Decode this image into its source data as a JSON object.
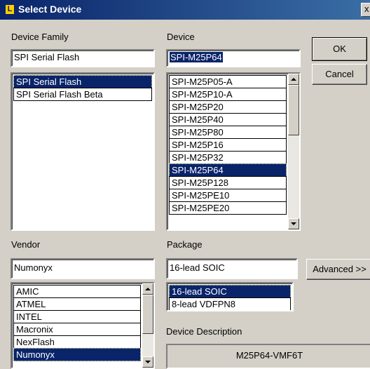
{
  "window": {
    "title": "Select Device",
    "close_glyph": "x"
  },
  "device_family": {
    "label": "Device Family",
    "value": "SPI Serial Flash",
    "items": [
      "SPI Serial Flash",
      "SPI Serial Flash Beta"
    ],
    "selected": "SPI Serial Flash"
  },
  "device": {
    "label": "Device",
    "value": "SPI-M25P64",
    "items": [
      "SPI-M25P05-A",
      "SPI-M25P10-A",
      "SPI-M25P20",
      "SPI-M25P40",
      "SPI-M25P80",
      "SPI-M25P16",
      "SPI-M25P32",
      "SPI-M25P64",
      "SPI-M25P128",
      "SPI-M25PE10",
      "SPI-M25PE20"
    ],
    "selected": "SPI-M25P64"
  },
  "buttons": {
    "ok": "OK",
    "cancel": "Cancel",
    "advanced": "Advanced >>"
  },
  "vendor": {
    "label": "Vendor",
    "value": "Numonyx",
    "items": [
      "AMIC",
      "ATMEL",
      "INTEL",
      "Macronix",
      "NexFlash",
      "Numonyx"
    ],
    "selected": "Numonyx"
  },
  "package": {
    "label": "Package",
    "value": "16-lead SOIC",
    "items": [
      "16-lead SOIC",
      "8-lead VDFPN8"
    ],
    "selected": "16-lead SOIC"
  },
  "description": {
    "label": "Device Description",
    "value": "M25P64-VMF6T"
  },
  "colors": {
    "titlebar": "#0a246a",
    "selection": "#0a246a",
    "face": "#d4d0c8"
  }
}
